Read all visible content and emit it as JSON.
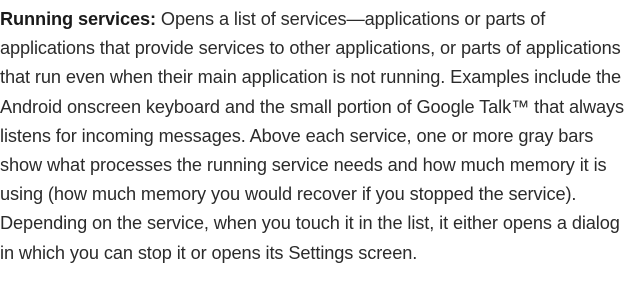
{
  "paragraph": {
    "term": "Running services:",
    "body": "Opens a list of services—applications or parts of applications that provide services to other applications, or parts of applications that run even when their main application is not running. Examples include the Android onscreen keyboard and the small portion of Google Talk™ that always listens for incoming messages. Above each service, one or more gray bars show what processes the running service needs and how much memory it is using (how much memory you would recover if you stopped the service). Depending on the service, when you touch it in the list, it either opens a dialog in which you can stop it or opens its Settings screen."
  }
}
